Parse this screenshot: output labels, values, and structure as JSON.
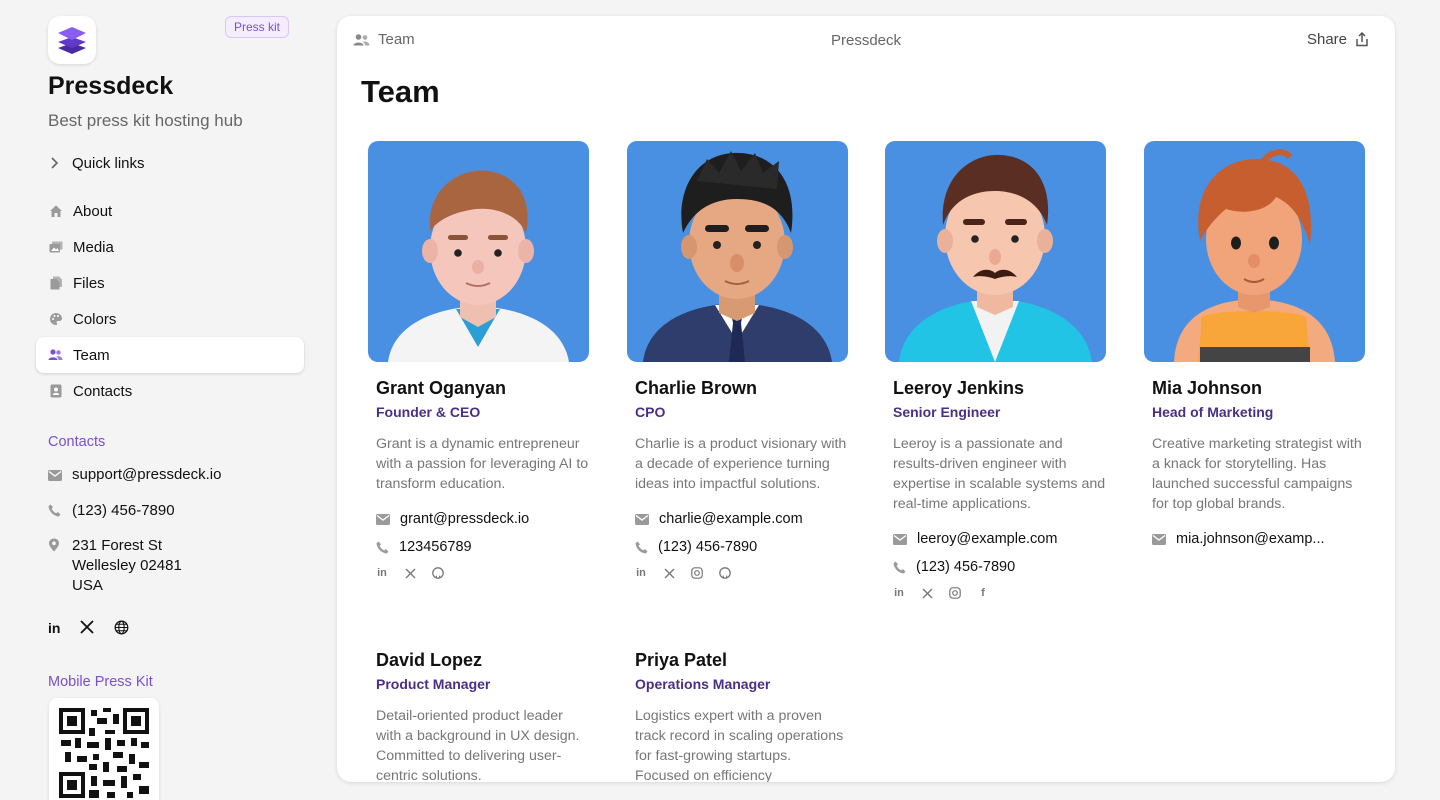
{
  "sidebar": {
    "brand": "Pressdeck",
    "badge": "Press kit",
    "tagline": "Best press kit hosting hub",
    "quick_links": "Quick links",
    "nav": [
      {
        "label": "About",
        "icon": "home-icon"
      },
      {
        "label": "Media",
        "icon": "images-icon"
      },
      {
        "label": "Files",
        "icon": "files-icon"
      },
      {
        "label": "Colors",
        "icon": "palette-icon"
      },
      {
        "label": "Team",
        "icon": "users-icon",
        "active": true
      },
      {
        "label": "Contacts",
        "icon": "contact-card-icon"
      }
    ],
    "contacts_title": "Contacts",
    "email": "support@pressdeck.io",
    "phone": "(123) 456-7890",
    "address": [
      "231 Forest St",
      "Wellesley 02481",
      "USA"
    ],
    "mobile_title": "Mobile Press Kit",
    "social": [
      "linkedin-icon",
      "x-icon",
      "globe-icon"
    ]
  },
  "header": {
    "crumb": "Team",
    "center": "Pressdeck",
    "share": "Share"
  },
  "main": {
    "title": "Team",
    "members": [
      {
        "name": "Grant Oganyan",
        "role": "Founder & CEO",
        "bio": "Grant is a dynamic entrepreneur with a passion for leveraging AI to transform education.",
        "email": "grant@pressdeck.io",
        "phone": "123456789",
        "social": [
          "linkedin-icon",
          "x-icon",
          "github-icon"
        ]
      },
      {
        "name": "Charlie Brown",
        "role": "CPO",
        "bio": "Charlie is a product visionary with a decade of experience turning ideas into impactful solutions.",
        "email": "charlie@example.com",
        "phone": "(123) 456-7890",
        "social": [
          "linkedin-icon",
          "x-icon",
          "instagram-icon",
          "github-icon"
        ]
      },
      {
        "name": "Leeroy Jenkins",
        "role": "Senior Engineer",
        "bio": "Leeroy is a passionate and results-driven engineer with expertise in scalable systems and real-time applications.",
        "email": "leeroy@example.com",
        "phone": "(123) 456-7890",
        "social": [
          "linkedin-icon",
          "x-icon",
          "instagram-icon",
          "facebook-icon"
        ]
      },
      {
        "name": "Mia Johnson",
        "role": "Head of Marketing",
        "bio": "Creative marketing strategist with a knack for storytelling. Has launched successful campaigns for top global brands.",
        "email": "mia.johnson@examp...",
        "phone": "",
        "social": []
      },
      {
        "name": "David Lopez",
        "role": "Product Manager",
        "bio": "Detail-oriented product leader with a background in UX design. Committed to delivering user-centric solutions.",
        "email": "",
        "phone": "",
        "social": []
      },
      {
        "name": "Priya Patel",
        "role": "Operations Manager",
        "bio": "Logistics expert with a proven track record in scaling operations for fast-growing startups. Focused on efficiency",
        "email": "",
        "phone": "",
        "social": []
      }
    ]
  },
  "colors": {
    "accent": "#7a4fd0",
    "role": "#4b2f86",
    "avatar_bg": "#4a90e2"
  }
}
